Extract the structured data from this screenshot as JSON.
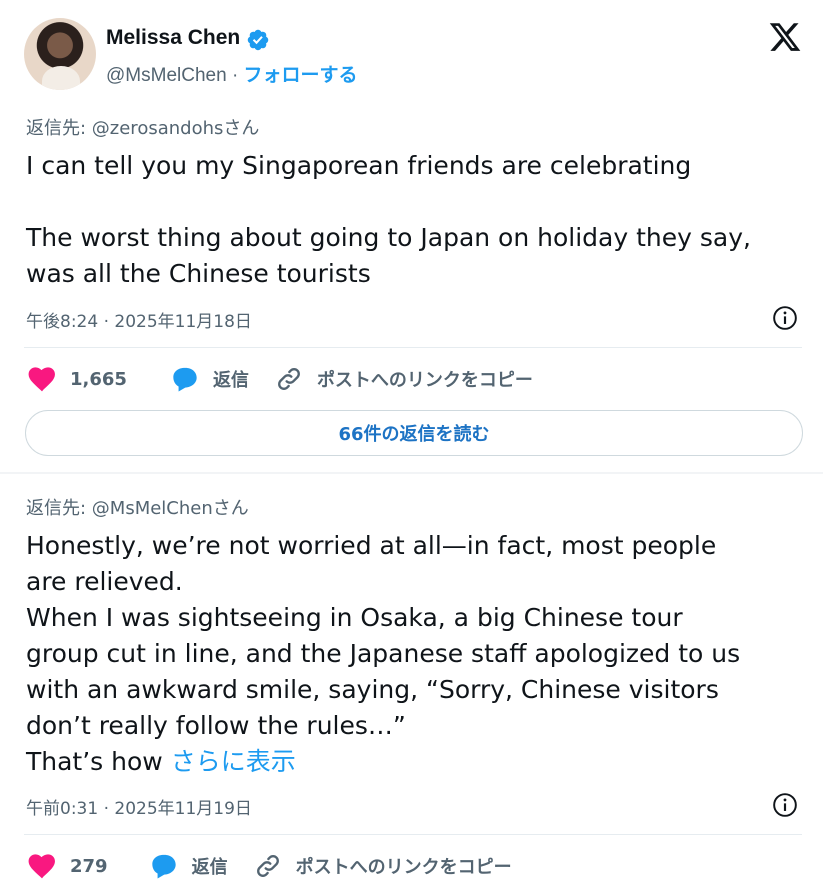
{
  "author": {
    "name": "Melissa Chen",
    "handle": "@MsMelChen",
    "separator": "·",
    "follow_label": "フォローする"
  },
  "icons": {
    "verified": "verified-badge-icon",
    "brand": "x-logo-icon",
    "like": "heart-icon",
    "reply": "speech-bubble-icon",
    "copy_link": "link-icon",
    "info": "info-icon"
  },
  "colors": {
    "accent": "#1d9bf0",
    "like": "#f91880",
    "muted": "#536471"
  },
  "tweet1": {
    "reply_to": "返信先: @zerosandohsさん",
    "text": "I can tell you my Singaporean friends are celebrating\n\nThe worst thing about going to Japan on holiday they say,\nwas all the Chinese tourists",
    "timestamp": "午後8:24 · 2025年11月18日",
    "likes": "1,665",
    "reply_label": "返信",
    "copy_link_label": "ポストへのリンクをコピー",
    "read_replies_label": "66件の返信を読む"
  },
  "tweet2": {
    "reply_to": "返信先: @MsMelChenさん",
    "text": "Honestly, we’re not worried at all—in fact, most people\nare relieved.\nWhen I was sightseeing in Osaka, a big Chinese tour\ngroup cut in line, and the Japanese staff apologized to us\nwith an awkward smile, saying, “Sorry, Chinese visitors\ndon’t really follow the rules…”\nThat’s how ",
    "show_more": "さらに表示",
    "timestamp": "午前0:31 · 2025年11月19日",
    "likes": "279",
    "reply_label": "返信",
    "copy_link_label": "ポストへのリンクをコピー"
  }
}
